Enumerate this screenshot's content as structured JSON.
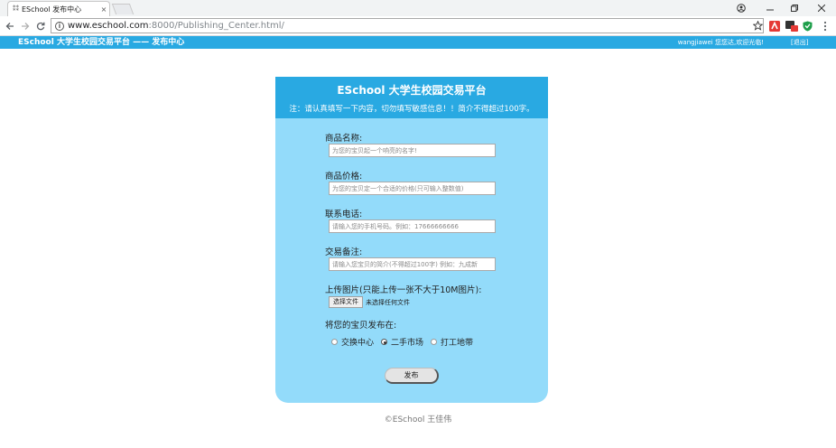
{
  "browser": {
    "tab_favicon": "⁑⁑",
    "tab_title": "ESchool 发布中心",
    "tab_close": "×",
    "url_host": "www.eschool.com",
    "url_path": ":8000/Publishing_Center.html/"
  },
  "site": {
    "brand": "ESchool 大学生校园交易平台 —— 发布中心",
    "user_greeting": "wangjiawei 您您达,欢迎光临!",
    "logout": "[退出]"
  },
  "form": {
    "title": "ESchool 大学生校园交易平台",
    "note": "注：请认真填写一下内容，切勿填写敏感信息！！简介不得超过100字。",
    "fields": [
      {
        "label": "商品名称:",
        "placeholder": "为您的宝贝起一个响亮的名字!"
      },
      {
        "label": "商品价格:",
        "placeholder": "为您的宝贝定一个合适的价格(只可输入整数值)"
      },
      {
        "label": "联系电话:",
        "placeholder": "请输入您的手机号码。例如：17666666666"
      },
      {
        "label": "交易备注:",
        "placeholder": "请输入您宝贝的简介(不得超过100字) 例如：九成新"
      }
    ],
    "upload_label": "上传图片(只能上传一张不大于10M图片):",
    "file_button": "选择文件",
    "file_none": "未选择任何文件",
    "publish_label": "将您的宝贝发布在:",
    "radio_options": [
      {
        "label": "交换中心",
        "checked": false
      },
      {
        "label": "二手市场",
        "checked": true
      },
      {
        "label": "打工地带",
        "checked": false
      }
    ],
    "submit": "发布"
  },
  "footer": "©ESchool 王佳伟",
  "colors": {
    "header": "#29a9e2",
    "card": "#93dbfa"
  }
}
